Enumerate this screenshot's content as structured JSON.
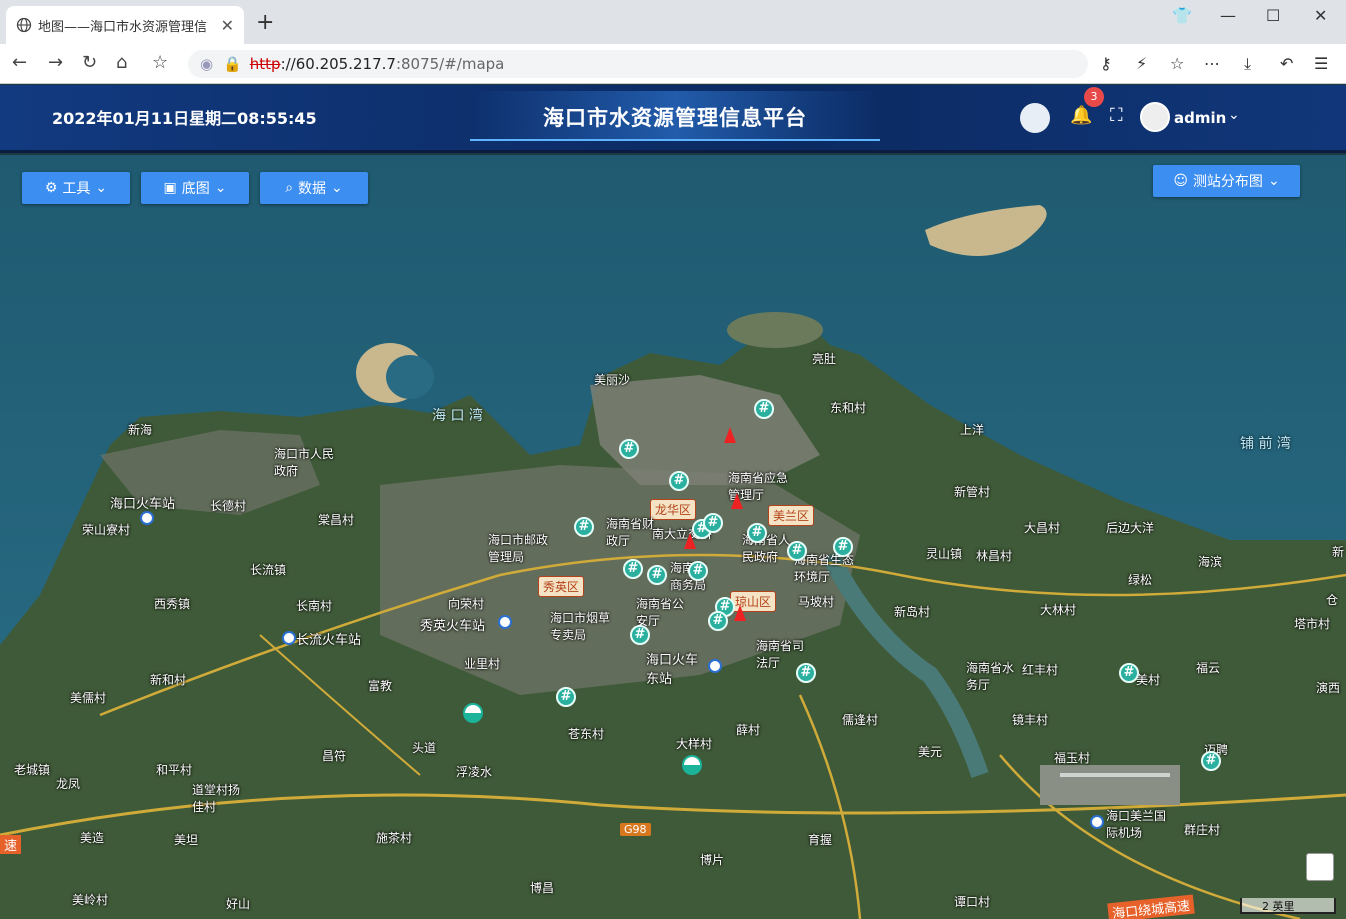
{
  "browser": {
    "tab_title": "地图——海口市水资源管理信",
    "url_protocol": "http",
    "url_host": "://60.205.217.7",
    "url_path": ":8075/#/mapa"
  },
  "header": {
    "datetime": "2022年01月11日星期二08:55:45",
    "title": "海口市水资源管理信息平台",
    "notification_count": "3",
    "username": "admin"
  },
  "toolbar": {
    "tools_label": "工具",
    "basemap_label": "底图",
    "data_label": "数据",
    "station_map_label": "测站分布图"
  },
  "map": {
    "bays": {
      "haikou_bay": "海 口 湾",
      "puqian_bay": "铺 前 湾"
    },
    "districts": {
      "longhua": "龙华区",
      "meilan": "美兰区",
      "xiuying": "秀英区",
      "qiongshan": "琼山区"
    },
    "places": {
      "p1": "美丽沙",
      "p2": "亮肚",
      "p3": "东和村",
      "p4": "上洋",
      "p5": "新海",
      "p6": "海口市人民政府",
      "p7": "海口火车站",
      "p8": "荣山寮村",
      "p9": "长德村",
      "p10": "棠昌村",
      "p11": "海南省应急管理厅",
      "p12": "海南省财政厅",
      "p13": "南大立交桥",
      "p14": "海南省人民政府",
      "p15": "海南省生态环境厅",
      "p16": "海口市邮政管理局",
      "p17": "新管村",
      "p18": "大昌村",
      "p19": "后边大洋",
      "p20": "灵山镇",
      "p21": "林昌村",
      "p22": "海滨",
      "p23": "绿松",
      "p24": "长流镇",
      "p25": "西秀镇",
      "p26": "长南村",
      "p27": "长流火车站",
      "p28": "向荣村",
      "p29": "秀英火车站",
      "p30": "海口市烟草专卖局",
      "p31": "海南省公安厅",
      "p32": "海南省商务局",
      "p33": "马坡村",
      "p34": "新岛村",
      "p35": "大林村",
      "p36": "塔市村",
      "p37": "海南省水务厅",
      "p38": "红丰村",
      "p39": "福云",
      "p40": "海口火车东站",
      "p41": "海南省司法厅",
      "p42": "新和村",
      "p43": "美儒村",
      "p44": "富教",
      "p45": "业里村",
      "p46": "苍东村",
      "p47": "大样村",
      "p48": "薛村",
      "p49": "儒逢村",
      "p50": "美元",
      "p51": "镜丰村",
      "p52": "福玉村",
      "p53": "迈聘",
      "p54": "老城镇",
      "p55": "龙凤",
      "p56": "和平村",
      "p57": "道堂村扬佳村",
      "p58": "昌符",
      "p59": "头道",
      "p60": "浮凌水",
      "p61": "美造",
      "p62": "美坦",
      "p63": "施茶村",
      "p64": "博片",
      "p65": "育握",
      "p66": "海口美兰国际机场",
      "p67": "群庄村",
      "p68": "美岭村",
      "p69": "好山",
      "p70": "博昌",
      "p71": "谭口村",
      "p72": "演西",
      "p73": "仓",
      "p74": "新",
      "p75": "新海",
      "p76": "美村"
    },
    "road_g98": "G98",
    "ring_road": "海口绕城高速",
    "left_road": "速",
    "scale_text": "2 英里"
  }
}
